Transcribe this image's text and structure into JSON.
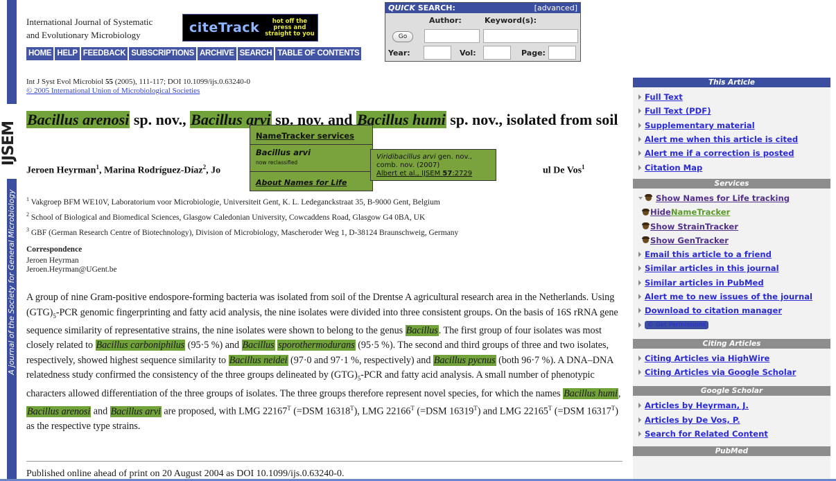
{
  "left_strip": {
    "logo": "IJSEM",
    "tagline": "A journal of the Society for General Microbiology"
  },
  "header": {
    "journal_title_line1": "International Journal of Systematic",
    "journal_title_line2": "and Evolutionary Microbiology",
    "citetrack": {
      "main": "citeTrack",
      "sub1": "hot off the",
      "sub2": "press and",
      "sub3": "straight to you"
    },
    "nav": [
      "HOME",
      "HELP",
      "FEEDBACK",
      "SUBSCRIPTIONS",
      "ARCHIVE",
      "SEARCH",
      "TABLE OF CONTENTS"
    ]
  },
  "quick_search": {
    "title_italic": "QUICK",
    "title_rest": " SEARCH:",
    "advanced": "[advanced]",
    "author_label": "Author:",
    "keyword_label": "Keyword(s):",
    "go_label": "Go",
    "year_label": "Year:",
    "vol_label": "Vol:",
    "page_label": "Page:",
    "author_value": "",
    "keyword_value": "",
    "year_value": "",
    "vol_value": "",
    "page_value": ""
  },
  "article": {
    "citation_pre": "Int J Syst Evol Microbiol ",
    "citation_vol": "55",
    "citation_post": " (2005), 111-117; DOI  10.1099/ijs.0.63240-0",
    "copyright": "© 2005 International Union of Microbiological Societies",
    "title": {
      "sp1": "Bacillus arenosi",
      "t1": " sp. nov., ",
      "sp2": "Bacillus arvi",
      "t2": " sp. nov. and ",
      "sp3": "Bacillus humi",
      "t3": " sp. nov., isolated from soil"
    },
    "authors": {
      "a1": "Jeroen Heyrman",
      "a1_sup": "1",
      "a2": "Marina Rodríguez-Díaz",
      "a2_sup": "2",
      "a3_partial": "Jo",
      "tail": "ul De Vos",
      "tail_sup": "1"
    },
    "affiliations": [
      {
        "sup": "1",
        "text": "Vakgroep BFM WE10V, Laboratorium voor Microbiologie, Universiteit Gent, K. L. Ledeganckstraat 35, B-9000 Gent, Belgium"
      },
      {
        "sup": "2",
        "text": "School of Biological and Biomedical Sciences, Glasgow Caledonian University, Cowcaddens Road, Glasgow G4 0BA, UK"
      },
      {
        "sup": "3",
        "text": "GBF (German Research Centre of Biotechnology), Division of Microbiology, Mascheroder Weg 1, D-38124 Braunschweig, Germany"
      }
    ],
    "correspondence": {
      "heading": "Correspondence",
      "name": "Jeroen Heyrman",
      "email": "Jeroen.Heyrman@UGent.be"
    },
    "abstract": {
      "p1": "A group of nine Gram-positive endospore-forming bacteria was isolated from soil of the Drentse A agricultural research area in the Netherlands. Using (GTG)",
      "sub1": "5",
      "p2": "-PCR genomic fingerprinting and fatty acid analysis, the nine isolates were divided into three consistent groups. On the basis of 16S rRNA gene sequence similarity of representative strains, the nine isolates were shown to belong to the genus ",
      "sp_bacillus": "Bacillus",
      "p3": ". The first group of four isolates was most closely related to ",
      "sp_carbon": "Bacillus carboniphilus",
      "p4": " (95·5 %) and ",
      "sp_sporo1": "Bacillus",
      "sp_sporo2": "sporothermodurans",
      "p5": " (95·5 %). The second and third groups of three and two isolates, respectively, showed highest sequence similarity to ",
      "sp_neidei": "Bacillus neidei",
      "p6": " (97·0 and 97·1 %, respectively) and ",
      "sp_pycnus": "Bacillus pycnus",
      "p7": " (both 96·7 %). A DNA–DNA relatedness study confirmed the consistency of the three groups delineated by (GTG)",
      "sub2": "5",
      "p8": "-PCR and fatty acid analysis. A small number of phenotypic characters allowed differentiation of the three groups of isolates. The three groups therefore represent novel species, for which the names ",
      "sp_humi": "Bacillus humi",
      "p9": ", ",
      "sp_arenosi": "Bacillus arenosi",
      "p10": " and ",
      "sp_arvi": "Bacillus arvi",
      "p11": " are proposed, with LMG 22167",
      "T": "T",
      "p12": " (=DSM 16318",
      "p13": "), LMG 22166",
      "p14": " (=DSM 16319",
      "p15": ") and LMG 22165",
      "p16": " (=DSM 16317",
      "p17": ") as the respective type strains."
    },
    "published": "Published online ahead of print on 20 August 2004 as DOI 10.1099/ijs.0.63240-0."
  },
  "nametracker_popup": {
    "services_link": "NameTracker services",
    "name": "Bacillus arvi",
    "status": "now reclassified",
    "about_link": "About Names for Life",
    "sub": {
      "new_name": "Viridibacillus arvi",
      "rank": " gen. nov.,",
      "line2": "comb. nov. (2007)",
      "ref_pre": "Albert et al., ",
      "ref_journal": "IJSEM ",
      "ref_vol": "57",
      "ref_page": ":2729"
    }
  },
  "sidebar": {
    "this_article": {
      "heading": "This Article",
      "items": [
        "Full Text",
        "Full Text (PDF)",
        "Supplementary material",
        "Alert me when this article is cited",
        "Alert me if a correction is posted",
        "Citation Map"
      ]
    },
    "services": {
      "heading": "Services",
      "n4l_toggle": "Show Names for Life tracking",
      "hide_label": "Hide ",
      "nametracker_label": "NameTracker",
      "strain_tracker": "Show StrainTracker",
      "gen_tracker": "Show GenTracker",
      "items": [
        "Email this article to a friend",
        "Similar articles in this journal",
        "Similar articles in PubMed",
        "Alert me to new issues of the journal",
        "Download to citation manager"
      ],
      "permissions": "© Get Permissions"
    },
    "citing_articles": {
      "heading": "Citing Articles",
      "items": [
        "Citing Articles via HighWire",
        "Citing Articles via Google Scholar"
      ]
    },
    "google_scholar": {
      "heading": "Google Scholar",
      "items": [
        "Articles by Heyrman, J.",
        "Articles by De Vos, P.",
        "Search for Related Content"
      ]
    },
    "pubmed": {
      "heading": "PubMed"
    }
  },
  "colors": {
    "brand_blue": "#3b4ea0",
    "highlight_green": "#72a23a",
    "link_blue": "#2a2ad6",
    "section_gray": "#8d8d8d"
  }
}
